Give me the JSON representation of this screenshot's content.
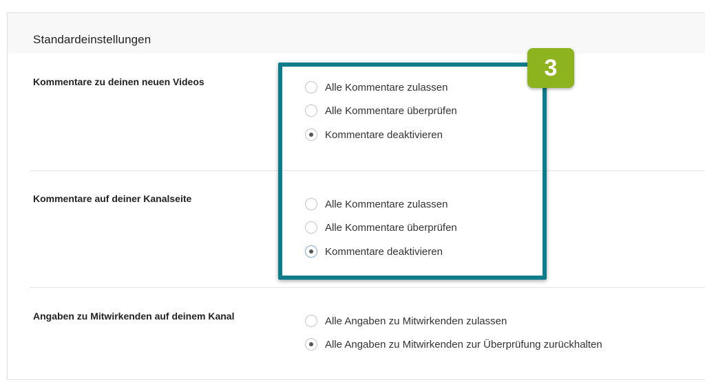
{
  "panel": {
    "title": "Standardeinstellungen"
  },
  "sections": [
    {
      "label": "Kommentare zu deinen neuen Videos",
      "options": [
        {
          "label": "Alle Kommentare zulassen",
          "selected": false
        },
        {
          "label": "Alle Kommentare überprüfen",
          "selected": false
        },
        {
          "label": "Kommentare deaktivieren",
          "selected": true
        }
      ]
    },
    {
      "label": "Kommentare auf deiner Kanalseite",
      "options": [
        {
          "label": "Alle Kommentare zulassen",
          "selected": false
        },
        {
          "label": "Alle Kommentare überprüfen",
          "selected": false
        },
        {
          "label": "Kommentare deaktivieren",
          "selected": true
        }
      ]
    },
    {
      "label": "Angaben zu Mitwirkenden auf deinem Kanal",
      "options": [
        {
          "label": "Alle Angaben zu Mitwirkenden zulassen",
          "selected": false
        },
        {
          "label": "Alle Angaben zu Mitwirkenden zur Überprüfung zurückhalten",
          "selected": true
        }
      ]
    }
  ],
  "annotation": {
    "step_number": "3",
    "badge_color": "#8db31f",
    "box_color": "#0f7c8c"
  }
}
